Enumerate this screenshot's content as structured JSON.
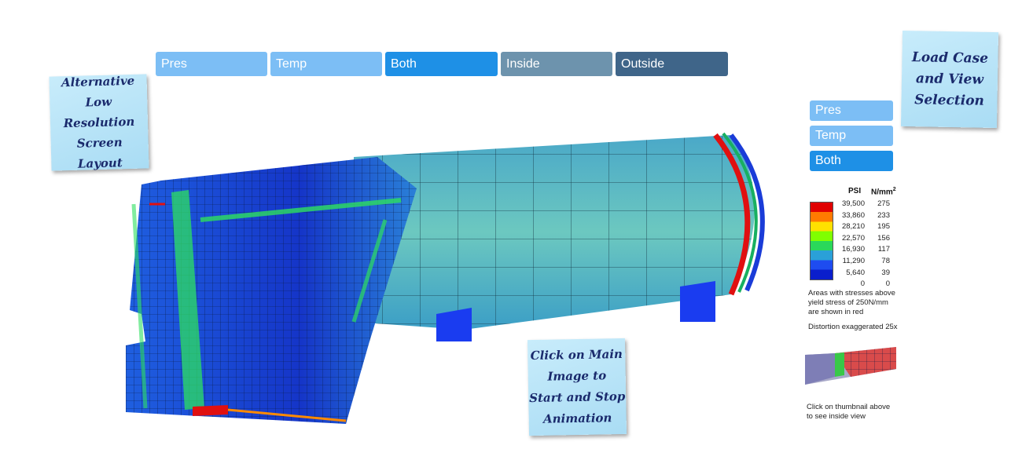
{
  "top_tabs": [
    {
      "label": "Pres",
      "color": "#7cbef5"
    },
    {
      "label": "Temp",
      "color": "#7cbef5"
    },
    {
      "label": "Both",
      "color": "#1e90e6"
    },
    {
      "label": "Inside",
      "color": "#6d93ad"
    },
    {
      "label": "Outside",
      "color": "#3f6589"
    }
  ],
  "side_buttons": [
    {
      "label": "Pres",
      "color": "#7cbef5"
    },
    {
      "label": "Temp",
      "color": "#7cbef5"
    },
    {
      "label": "Both",
      "color": "#1e90e6"
    }
  ],
  "notes": {
    "left": "Alternative\nLow\nResolution Screen\nLayout",
    "right": "Load Case\nand View\nSelection",
    "bottom": "Click on Main\nImage to\nStart and Stop\nAnimation"
  },
  "legend": {
    "psi_header": "PSI",
    "nmm_header": "N/mm",
    "nmm_sup": "2",
    "rows": [
      {
        "psi": "39,500",
        "nmm": "275"
      },
      {
        "psi": "33,860",
        "nmm": "233"
      },
      {
        "psi": "28,210",
        "nmm": "195"
      },
      {
        "psi": "22,570",
        "nmm": "156"
      },
      {
        "psi": "16,930",
        "nmm": "117"
      },
      {
        "psi": "11,290",
        "nmm": "78"
      },
      {
        "psi": "5,640",
        "nmm": "39"
      },
      {
        "psi": "0",
        "nmm": "0"
      }
    ],
    "colors": [
      "#e00000",
      "#ff7a00",
      "#ffe000",
      "#80ff00",
      "#2ad85a",
      "#2aa0d8",
      "#1e4cf0",
      "#0a1ecc"
    ],
    "note_stress": "Areas with stresses above\nyield stress of 250N/mm\nare shown in red",
    "note_distortion": "Distortion exaggerated 25x",
    "thumbnail_caption": "Click on thumbnail above\nto see inside view"
  }
}
